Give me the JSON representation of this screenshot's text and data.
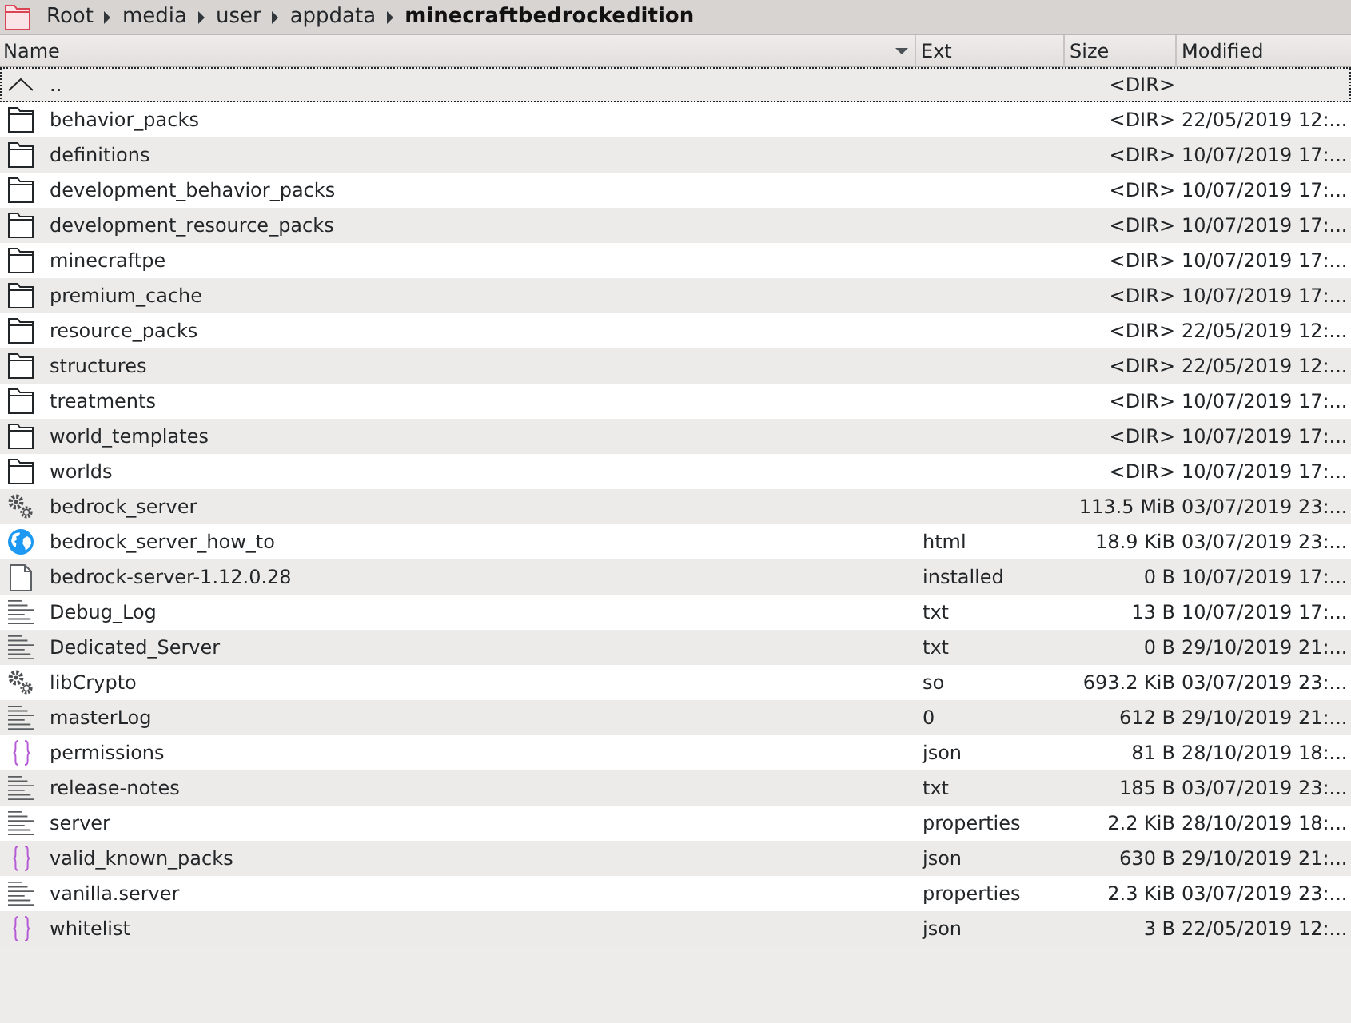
{
  "breadcrumb": [
    {
      "label": "Root",
      "current": false
    },
    {
      "label": "media",
      "current": false
    },
    {
      "label": "user",
      "current": false
    },
    {
      "label": "appdata",
      "current": false
    },
    {
      "label": "minecraftbedrockedition",
      "current": true
    }
  ],
  "columns": [
    {
      "label": "Name",
      "sorted": true
    },
    {
      "label": "Ext",
      "sorted": false
    },
    {
      "label": "Size",
      "sorted": false
    },
    {
      "label": "Modified",
      "sorted": false
    }
  ],
  "rows": [
    {
      "kind": "parent",
      "name": "..",
      "size": "<DIR>",
      "focused": true
    },
    {
      "kind": "folder",
      "name": "behavior_packs",
      "size": "<DIR>",
      "modified": "22/05/2019 12:...",
      "focused": false
    },
    {
      "kind": "folder",
      "name": "definitions",
      "size": "<DIR>",
      "modified": "10/07/2019 17:...",
      "focused": false
    },
    {
      "kind": "folder",
      "name": "development_behavior_packs",
      "size": "<DIR>",
      "modified": "10/07/2019 17:...",
      "focused": false
    },
    {
      "kind": "folder",
      "name": "development_resource_packs",
      "size": "<DIR>",
      "modified": "10/07/2019 17:...",
      "focused": false
    },
    {
      "kind": "folder",
      "name": "minecraftpe",
      "size": "<DIR>",
      "modified": "10/07/2019 17:...",
      "focused": false
    },
    {
      "kind": "folder",
      "name": "premium_cache",
      "size": "<DIR>",
      "modified": "10/07/2019 17:...",
      "focused": false
    },
    {
      "kind": "folder",
      "name": "resource_packs",
      "size": "<DIR>",
      "modified": "22/05/2019 12:...",
      "focused": false
    },
    {
      "kind": "folder",
      "name": "structures",
      "size": "<DIR>",
      "modified": "22/05/2019 12:...",
      "focused": false
    },
    {
      "kind": "folder",
      "name": "treatments",
      "size": "<DIR>",
      "modified": "10/07/2019 17:...",
      "focused": false
    },
    {
      "kind": "folder",
      "name": "world_templates",
      "size": "<DIR>",
      "modified": "10/07/2019 17:...",
      "focused": false
    },
    {
      "kind": "folder",
      "name": "worlds",
      "size": "<DIR>",
      "modified": "10/07/2019 17:...",
      "focused": false
    },
    {
      "kind": "executable",
      "name": "bedrock_server",
      "size": "113.5 MiB",
      "modified": "03/07/2019 23:...",
      "focused": false
    },
    {
      "kind": "web",
      "name": "bedrock_server_how_to",
      "ext": "html",
      "size": "18.9 KiB",
      "modified": "03/07/2019 23:...",
      "focused": false
    },
    {
      "kind": "file",
      "name": "bedrock-server-1.12.0.28",
      "ext": "installed",
      "size": "0 B",
      "modified": "10/07/2019 17:...",
      "focused": false
    },
    {
      "kind": "text",
      "name": "Debug_Log",
      "ext": "txt",
      "size": "13 B",
      "modified": "10/07/2019 17:...",
      "focused": false
    },
    {
      "kind": "text",
      "name": "Dedicated_Server",
      "ext": "txt",
      "size": "0 B",
      "modified": "29/10/2019 21:...",
      "focused": false
    },
    {
      "kind": "executable",
      "name": "libCrypto",
      "ext": "so",
      "size": "693.2 KiB",
      "modified": "03/07/2019 23:...",
      "focused": false
    },
    {
      "kind": "text",
      "name": "masterLog",
      "ext": "0",
      "size": "612 B",
      "modified": "29/10/2019 21:...",
      "focused": false
    },
    {
      "kind": "json",
      "name": "permissions",
      "ext": "json",
      "size": "81 B",
      "modified": "28/10/2019 18:...",
      "focused": false
    },
    {
      "kind": "text",
      "name": "release-notes",
      "ext": "txt",
      "size": "185 B",
      "modified": "03/07/2019 23:...",
      "focused": false
    },
    {
      "kind": "text",
      "name": "server",
      "ext": "properties",
      "size": "2.2 KiB",
      "modified": "28/10/2019 18:...",
      "focused": false
    },
    {
      "kind": "json",
      "name": "valid_known_packs",
      "ext": "json",
      "size": "630 B",
      "modified": "29/10/2019 21:...",
      "focused": false
    },
    {
      "kind": "text",
      "name": "vanilla.server",
      "ext": "properties",
      "size": "2.3 KiB",
      "modified": "03/07/2019 23:...",
      "focused": false
    },
    {
      "kind": "json",
      "name": "whitelist",
      "ext": "json",
      "size": "3 B",
      "modified": "22/05/2019 12:...",
      "focused": false
    }
  ]
}
